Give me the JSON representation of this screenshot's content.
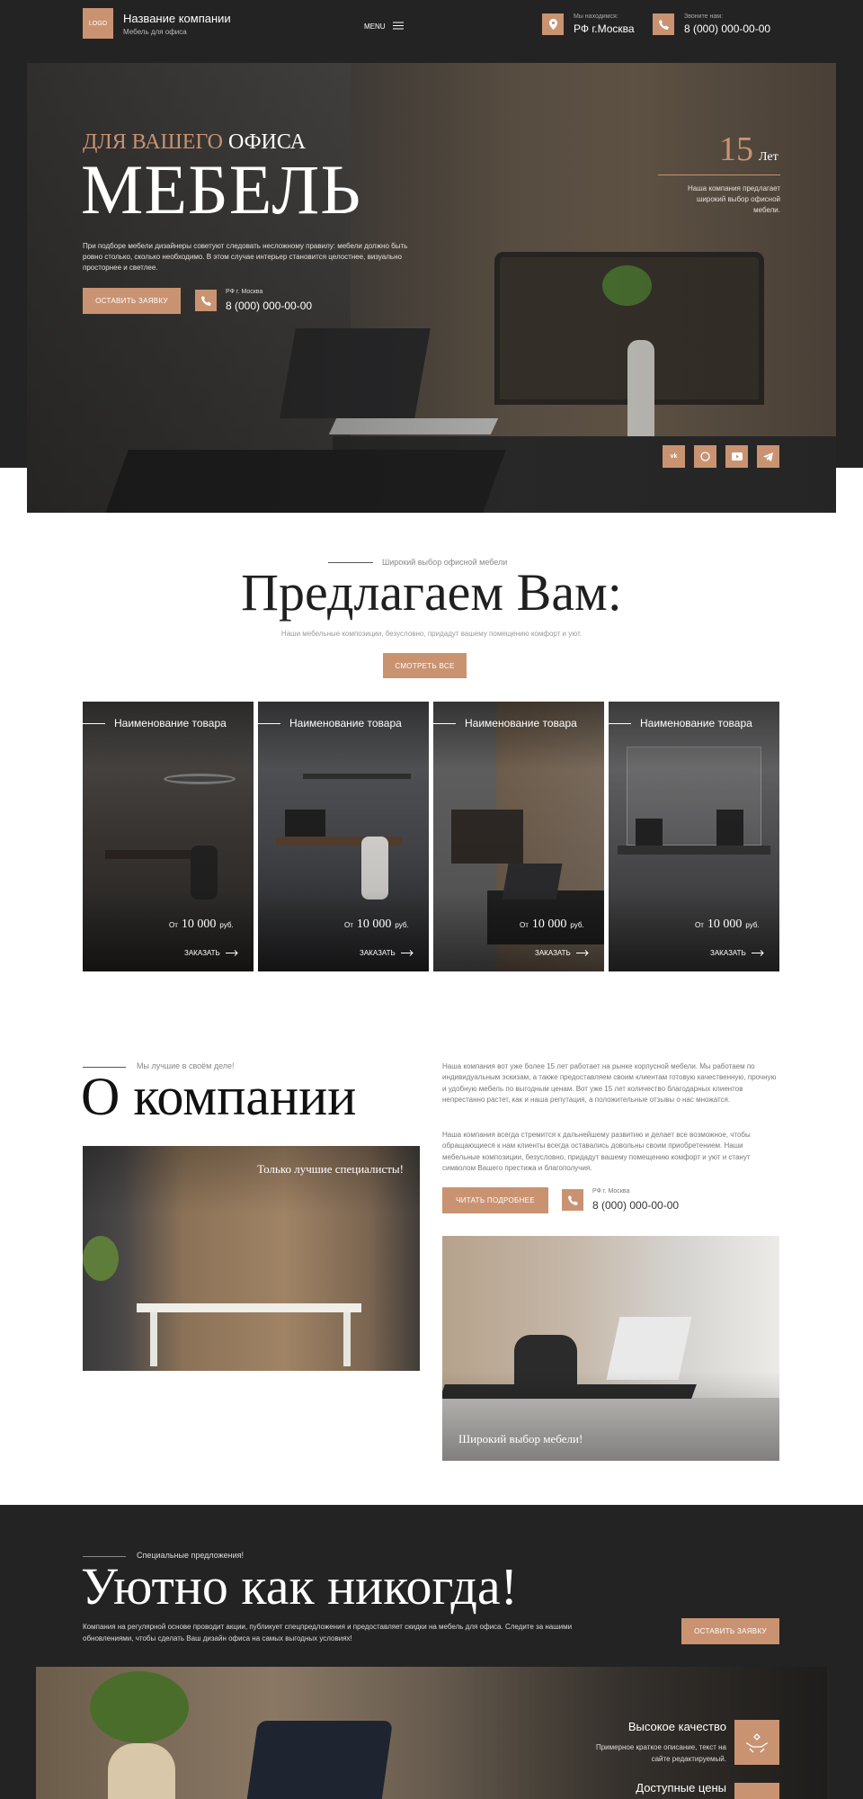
{
  "header": {
    "logo": "LOGO",
    "company": "Название компании",
    "tagline": "Мебель для офиса",
    "menu": "MENU",
    "location_label": "Мы находимся:",
    "location": "РФ г.Москва",
    "phone_label": "Звоните нам:",
    "phone": "8 (000) 000-00-00"
  },
  "hero": {
    "for_prefix": "ДЛЯ ВАШЕГО",
    "for_suffix": "ОФИСА",
    "title": "МЕБЕЛЬ",
    "text": "При подборе мебели дизайнеры советуют следовать несложному правилу: мебели должно быть ровно столько, сколько необходимо. В этом случае интерьер становится целостнее, визуально просторнее и светлее.",
    "cta": "ОСТАВИТЬ ЗАЯВКУ",
    "contact_label": "РФ г. Москва",
    "contact_phone": "8 (000) 000-00-00",
    "years_num": "15",
    "years_word": "Лет",
    "years_text": "Наша компания предлагает широкий выбор офисной мебели.",
    "socials": [
      "vk",
      "whatsapp",
      "youtube",
      "telegram"
    ]
  },
  "offer": {
    "kicker": "Широкий выбор офисной мебели",
    "title": "Предлагаем Вам:",
    "sub": "Наши мебельные композиции, безусловно, придадут вашему помещению комфорт и уют.",
    "button": "СМОТРЕТЬ ВСЕ",
    "products": [
      {
        "name": "Наименование товара",
        "price_from": "От",
        "price": "10 000",
        "currency": "руб.",
        "order": "ЗАКАЗАТЬ"
      },
      {
        "name": "Наименование товара",
        "price_from": "От",
        "price": "10 000",
        "currency": "руб.",
        "order": "ЗАКАЗАТЬ"
      },
      {
        "name": "Наименование товара",
        "price_from": "От",
        "price": "10 000",
        "currency": "руб.",
        "order": "ЗАКАЗАТЬ"
      },
      {
        "name": "Наименование товара",
        "price_from": "От",
        "price": "10 000",
        "currency": "руб.",
        "order": "ЗАКАЗАТЬ"
      }
    ]
  },
  "about": {
    "kicker": "Мы лучшие в своём деле!",
    "title": "О компании",
    "text1": "Наша компания вот уже более 15 лет работает на рынке корпусной мебели. Мы работаем по индивидуальным эскизам, а также предоставляем своим клиентам готовую качественную, прочную и удобную мебель по выгодным ценам. Вот уже 15 лет количество благодарных клиентов непрестанно растет, как и наша репутация, а положительные отзывы о нас множатся.",
    "text2": "Наша компания всегда стремится к дальнейшему развитию и делает все возможное, чтобы обращающиеся к нам клиенты всегда оставались довольны своим приобретением. Наши мебельные композиции, безусловно, придадут вашему помещению комфорт и уют и станут символом Вашего престижа и благополучия.",
    "button": "ЧИТАТЬ ПОДРОБНЕЕ",
    "contact_label": "РФ г. Москва",
    "contact_phone": "8 (000) 000-00-00",
    "img1_caption": "Только лучшие специалисты!",
    "img2_caption": "Широкий выбор мебели!"
  },
  "special": {
    "kicker": "Специальные предложения!",
    "title": "Уютно как никогда!",
    "text": "Компания на регулярной основе проводит акции, публикует спецпредложения и предоставляет скидки на мебель для офиса. Следите за нашими обновлениями, чтобы сделать Ваш дизайн офиса на самых выгодных условиях!",
    "button": "ОСТАВИТЬ ЗАЯВКУ",
    "feature1_title": "Высокое качество",
    "feature1_text": "Примерное краткое описание, текст на сайте редактируемый.",
    "feature2_title": "Доступные цены"
  },
  "colors": {
    "accent": "#c99372",
    "dark": "#232323"
  }
}
